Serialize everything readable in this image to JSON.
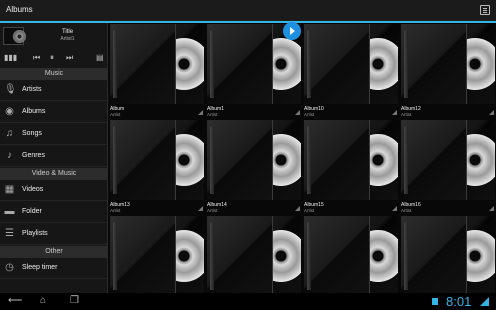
{
  "actionbar": {
    "title": "Albums"
  },
  "now_playing": {
    "title": "Title",
    "artist": "Artist1"
  },
  "sidebar": {
    "sections": [
      {
        "header": "Music",
        "items": [
          {
            "label": "Artists",
            "icon": "microphone-icon"
          },
          {
            "label": "Albums",
            "icon": "disc-icon"
          },
          {
            "label": "Songs",
            "icon": "music-note-icon"
          },
          {
            "label": "Genres",
            "icon": "guitar-icon"
          }
        ]
      },
      {
        "header": "Video & Music",
        "items": [
          {
            "label": "Videos",
            "icon": "film-icon"
          },
          {
            "label": "Folder",
            "icon": "folder-icon"
          },
          {
            "label": "Playlists",
            "icon": "playlist-icon"
          }
        ]
      },
      {
        "header": "Other",
        "items": [
          {
            "label": "Sleep timer",
            "icon": "clock-icon"
          }
        ]
      }
    ]
  },
  "albums": [
    {
      "name": "Album",
      "artist": "Artist"
    },
    {
      "name": "Album1",
      "artist": "Artist"
    },
    {
      "name": "Album10",
      "artist": "Artist"
    },
    {
      "name": "Album12",
      "artist": "Artist"
    },
    {
      "name": "Album13",
      "artist": "Artist"
    },
    {
      "name": "Album14",
      "artist": "Artist"
    },
    {
      "name": "Album15",
      "artist": "Artist"
    },
    {
      "name": "Album16",
      "artist": "Artist"
    },
    {
      "name": "",
      "artist": ""
    },
    {
      "name": "",
      "artist": ""
    },
    {
      "name": "",
      "artist": ""
    },
    {
      "name": "",
      "artist": ""
    }
  ],
  "status": {
    "time": "8:01"
  },
  "colors": {
    "accent": "#33b5e5",
    "fab": "#1e90e0"
  }
}
